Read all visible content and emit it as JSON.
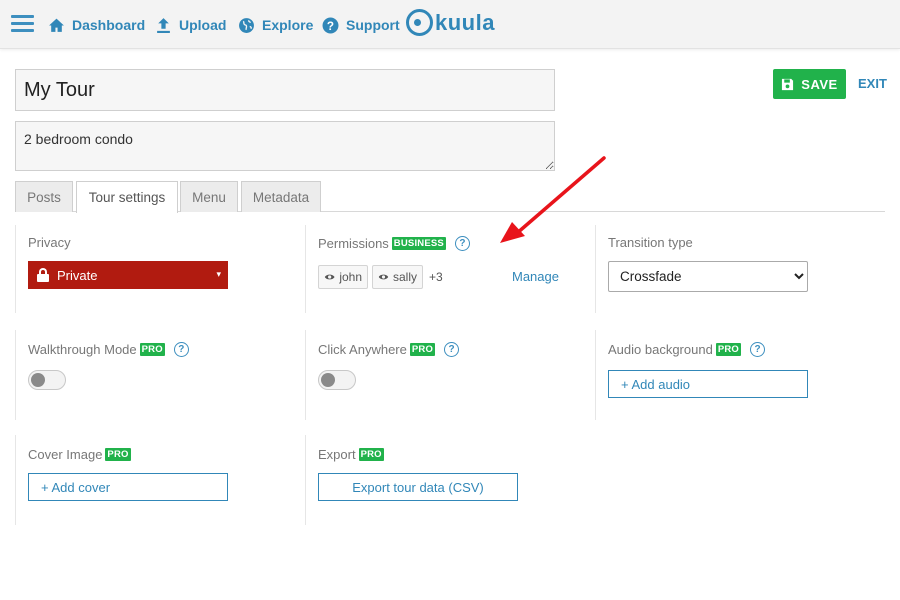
{
  "nav": {
    "items": [
      {
        "label": "Dashboard",
        "icon": "home-icon"
      },
      {
        "label": "Upload",
        "icon": "upload-icon"
      },
      {
        "label": "Explore",
        "icon": "globe-icon"
      },
      {
        "label": "Support",
        "icon": "help-circle-icon"
      }
    ],
    "logo_text": "kuula"
  },
  "tour": {
    "title": "My Tour",
    "description": "2 bedroom condo"
  },
  "actions": {
    "save_label": "SAVE",
    "exit_label": "EXIT"
  },
  "tabs": [
    "Posts",
    "Tour settings",
    "Menu",
    "Metadata"
  ],
  "active_tab": "Tour settings",
  "settings": {
    "privacy": {
      "label": "Privacy",
      "value": "Private",
      "caret": "▾"
    },
    "permissions": {
      "label": "Permissions",
      "badge": "BUSINESS",
      "users": [
        "john",
        "sally"
      ],
      "more": "+3",
      "manage_label": "Manage"
    },
    "transition": {
      "label": "Transition type",
      "value": "Crossfade",
      "options": [
        "Crossfade"
      ]
    },
    "walkthrough": {
      "label": "Walkthrough Mode",
      "badge": "PRO",
      "enabled": false
    },
    "click_anywhere": {
      "label": "Click Anywhere",
      "badge": "PRO",
      "enabled": false
    },
    "audio": {
      "label": "Audio background",
      "badge": "PRO",
      "button_label": "+ Add audio"
    },
    "cover": {
      "label": "Cover Image",
      "badge": "PRO",
      "button_label": "+ Add cover"
    },
    "export": {
      "label": "Export",
      "badge": "PRO",
      "button_label": "Export tour data (CSV)"
    }
  },
  "help_glyph": "?",
  "colors": {
    "accent": "#3187b8",
    "save": "#21b24b",
    "privacy_private": "#b11b10",
    "annotation_arrow": "#e8141b"
  }
}
